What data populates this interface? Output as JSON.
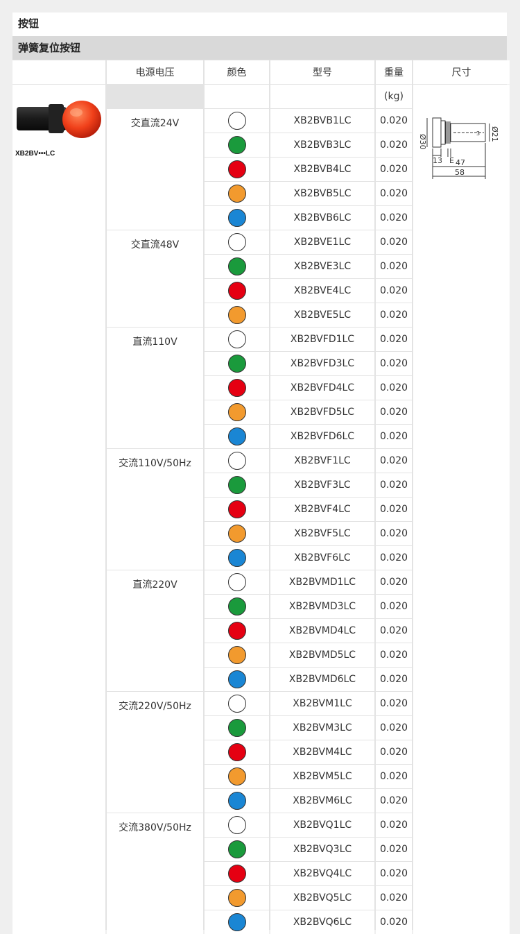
{
  "title": "按钮",
  "subtitle": "弹簧复位按钮",
  "headers": {
    "voltage": "电源电压",
    "color": "颜色",
    "model": "型号",
    "weight": "重量",
    "size": "尺寸"
  },
  "weight_unit": "(kg)",
  "product_label": "XB2BV•••LC",
  "colors": {
    "white": "#ffffff",
    "green": "#1a9a3c",
    "red": "#e50012",
    "orange": "#f29a2e",
    "blue": "#1a86d4"
  },
  "dimensions": {
    "d30": "Ø30",
    "d21": "Ø21",
    "w13": "13",
    "e": "E",
    "w47": "47",
    "w58": "58",
    "pin": "3"
  },
  "groups": [
    {
      "voltage": "交直流24V",
      "rows": [
        {
          "color": "white",
          "model": "XB2BVB1LC",
          "weight": "0.020"
        },
        {
          "color": "green",
          "model": "XB2BVB3LC",
          "weight": "0.020"
        },
        {
          "color": "red",
          "model": "XB2BVB4LC",
          "weight": "0.020"
        },
        {
          "color": "orange",
          "model": "XB2BVB5LC",
          "weight": "0.020"
        },
        {
          "color": "blue",
          "model": "XB2BVB6LC",
          "weight": "0.020"
        }
      ]
    },
    {
      "voltage": "交直流48V",
      "rows": [
        {
          "color": "white",
          "model": "XB2BVE1LC",
          "weight": "0.020"
        },
        {
          "color": "green",
          "model": "XB2BVE3LC",
          "weight": "0.020"
        },
        {
          "color": "red",
          "model": "XB2BVE4LC",
          "weight": "0.020"
        },
        {
          "color": "orange",
          "model": "XB2BVE5LC",
          "weight": "0.020"
        }
      ]
    },
    {
      "voltage": "直流110V",
      "rows": [
        {
          "color": "white",
          "model": "XB2BVFD1LC",
          "weight": "0.020"
        },
        {
          "color": "green",
          "model": "XB2BVFD3LC",
          "weight": "0.020"
        },
        {
          "color": "red",
          "model": "XB2BVFD4LC",
          "weight": "0.020"
        },
        {
          "color": "orange",
          "model": "XB2BVFD5LC",
          "weight": "0.020"
        },
        {
          "color": "blue",
          "model": "XB2BVFD6LC",
          "weight": "0.020"
        }
      ]
    },
    {
      "voltage": "交流110V/50Hz",
      "rows": [
        {
          "color": "white",
          "model": "XB2BVF1LC",
          "weight": "0.020"
        },
        {
          "color": "green",
          "model": "XB2BVF3LC",
          "weight": "0.020"
        },
        {
          "color": "red",
          "model": "XB2BVF4LC",
          "weight": "0.020"
        },
        {
          "color": "orange",
          "model": "XB2BVF5LC",
          "weight": "0.020"
        },
        {
          "color": "blue",
          "model": "XB2BVF6LC",
          "weight": "0.020"
        }
      ]
    },
    {
      "voltage": "直流220V",
      "rows": [
        {
          "color": "white",
          "model": "XB2BVMD1LC",
          "weight": "0.020"
        },
        {
          "color": "green",
          "model": "XB2BVMD3LC",
          "weight": "0.020"
        },
        {
          "color": "red",
          "model": "XB2BVMD4LC",
          "weight": "0.020"
        },
        {
          "color": "orange",
          "model": "XB2BVMD5LC",
          "weight": "0.020"
        },
        {
          "color": "blue",
          "model": "XB2BVMD6LC",
          "weight": "0.020"
        }
      ]
    },
    {
      "voltage": "交流220V/50Hz",
      "rows": [
        {
          "color": "white",
          "model": "XB2BVM1LC",
          "weight": "0.020"
        },
        {
          "color": "green",
          "model": "XB2BVM3LC",
          "weight": "0.020"
        },
        {
          "color": "red",
          "model": "XB2BVM4LC",
          "weight": "0.020"
        },
        {
          "color": "orange",
          "model": "XB2BVM5LC",
          "weight": "0.020"
        },
        {
          "color": "blue",
          "model": "XB2BVM6LC",
          "weight": "0.020"
        }
      ]
    },
    {
      "voltage": "交流380V/50Hz",
      "rows": [
        {
          "color": "white",
          "model": "XB2BVQ1LC",
          "weight": "0.020"
        },
        {
          "color": "green",
          "model": "XB2BVQ3LC",
          "weight": "0.020"
        },
        {
          "color": "red",
          "model": "XB2BVQ4LC",
          "weight": "0.020"
        },
        {
          "color": "orange",
          "model": "XB2BVQ5LC",
          "weight": "0.020"
        },
        {
          "color": "blue",
          "model": "XB2BVQ6LC",
          "weight": "0.020"
        }
      ]
    }
  ]
}
